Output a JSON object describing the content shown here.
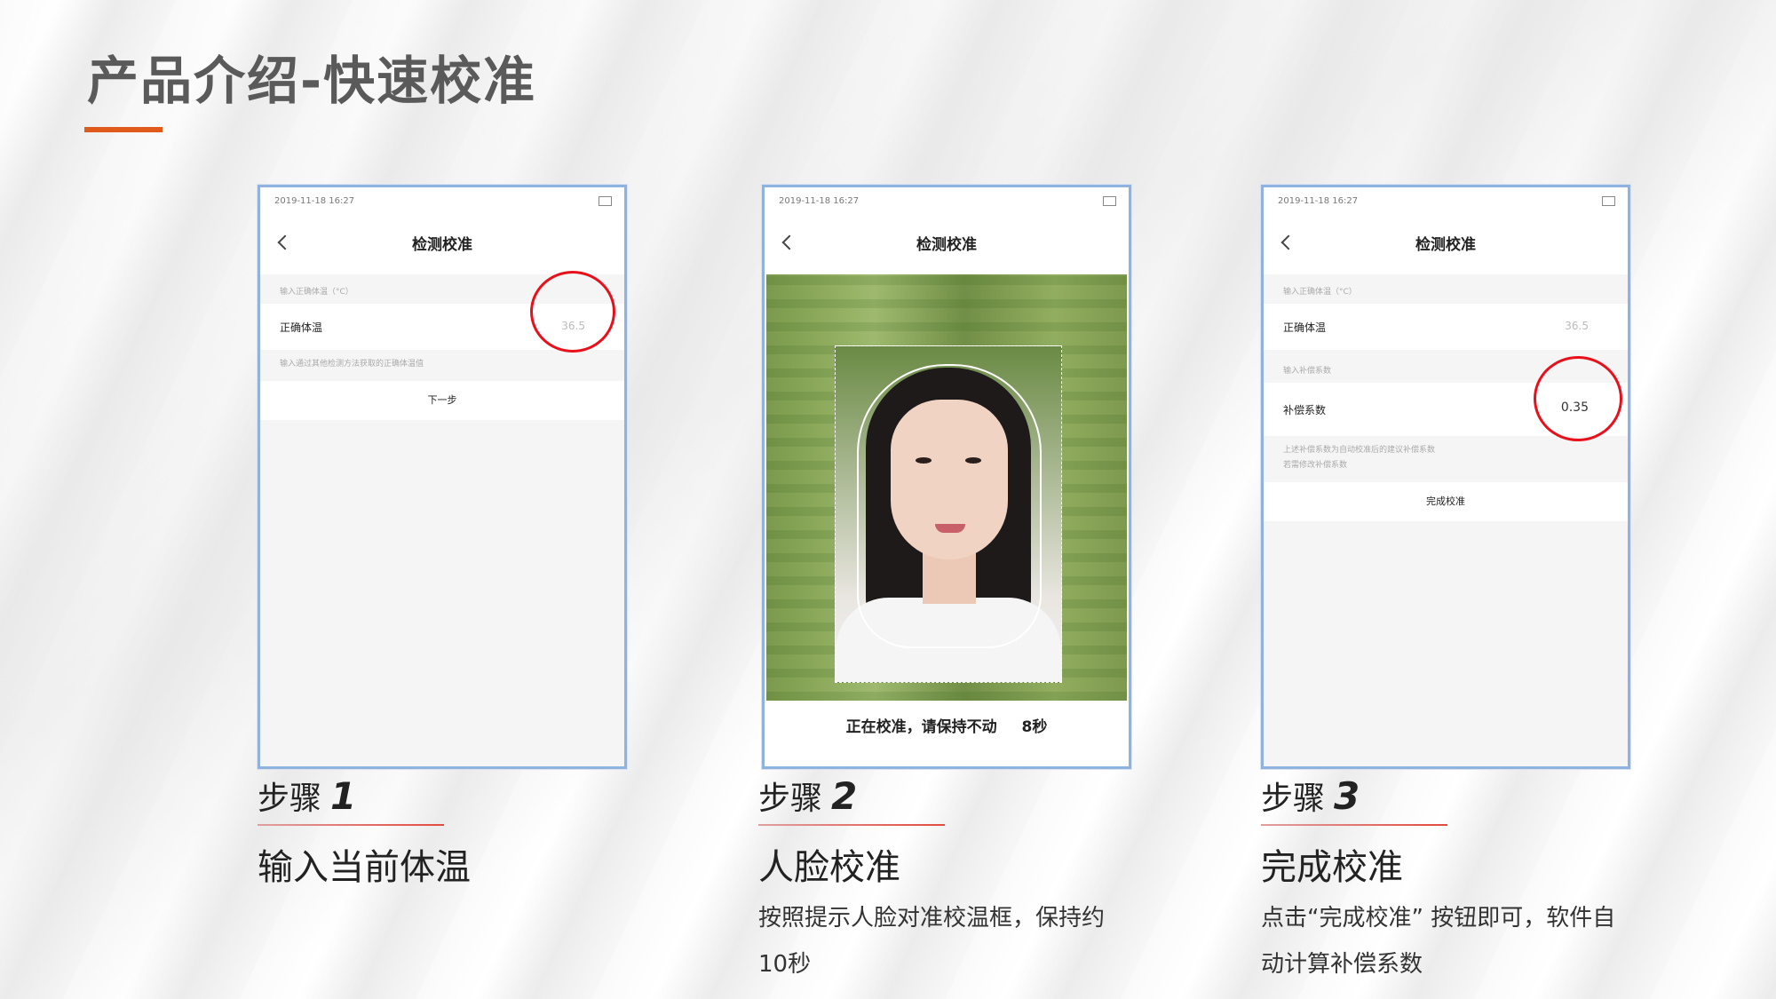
{
  "slide": {
    "title": "产品介绍-快速校准"
  },
  "phone1": {
    "status_time": "2019-11-18 16:27",
    "nav_title": "检测校准",
    "hint_top": "输入正确体温（°C）",
    "row_label": "正确体温",
    "row_value": "36.5",
    "hint_bottom": "输入通过其他检测方法获取的正确体温值",
    "action_label": "下一步"
  },
  "phone2": {
    "status_time": "2019-11-18 16:27",
    "nav_title": "检测校准",
    "calibrating_text": "正在校准，请保持不动",
    "countdown": "8秒"
  },
  "phone3": {
    "status_time": "2019-11-18 16:27",
    "nav_title": "检测校准",
    "hint_top": "输入正确体温（°C）",
    "row1_label": "正确体温",
    "row1_value": "36.5",
    "hint_mid": "输入补偿系数",
    "row2_label": "补偿系数",
    "row2_value": "0.35",
    "hint_bottom_1": "上述补偿系数为自动校准后的建议补偿系数",
    "hint_bottom_2": "若需修改补偿系数",
    "action_label": "完成校准"
  },
  "steps": [
    {
      "label": "步骤",
      "num": "1",
      "title": "输入当前体温",
      "desc_1": "",
      "desc_2": ""
    },
    {
      "label": "步骤",
      "num": "2",
      "title": "人脸校准",
      "desc_1": "按照提示人脸对准校温框，保持约",
      "desc_2": "10秒"
    },
    {
      "label": "步骤",
      "num": "3",
      "title": "完成校准",
      "desc_1": "点击“完成校准” 按钮即可，软件自",
      "desc_2": "动计算补偿系数"
    }
  ],
  "colors": {
    "accent": "#e05a1c",
    "highlight_circle": "#e8101a",
    "phone_border": "#8fb3de"
  }
}
